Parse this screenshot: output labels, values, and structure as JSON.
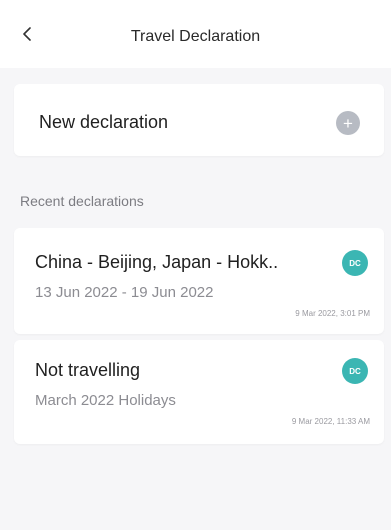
{
  "header": {
    "title": "Travel Declaration",
    "back_icon": "chevron-left-icon"
  },
  "new_declaration": {
    "label": "New declaration",
    "icon": "plus-icon",
    "icon_color": "#b7bbc3"
  },
  "recent": {
    "section_title": "Recent declarations",
    "items": [
      {
        "title": "China - Beijing, Japan - Hokk..",
        "subtitle": "13 Jun 2022 - 19 Jun 2022",
        "timestamp": "9 Mar 2022, 3:01 PM",
        "avatar": "DC",
        "avatar_color": "#3bb6b3"
      },
      {
        "title": "Not travelling",
        "subtitle": "March 2022 Holidays",
        "timestamp": "9 Mar 2022, 11:33 AM",
        "avatar": "DC",
        "avatar_color": "#3bb6b3"
      }
    ]
  }
}
